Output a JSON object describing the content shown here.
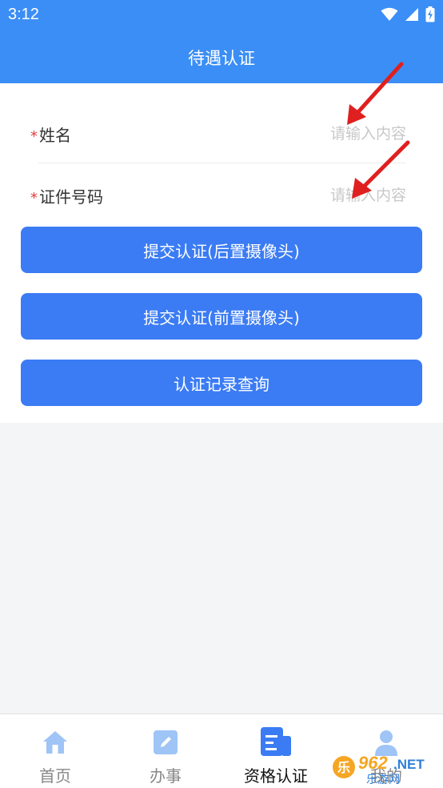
{
  "status_bar": {
    "time": "3:12",
    "icons": [
      "wifi-icon",
      "signal-icon",
      "battery-charging-icon"
    ]
  },
  "header": {
    "title": "待遇认证"
  },
  "form": {
    "fields": [
      {
        "required_mark": "*",
        "label": "姓名",
        "placeholder": "请输入内容",
        "value": ""
      },
      {
        "required_mark": "*",
        "label": "证件号码",
        "placeholder": "请输入内容",
        "value": ""
      }
    ]
  },
  "buttons": {
    "back_camera": "提交认证(后置摄像头)",
    "front_camera": "提交认证(前置摄像头)",
    "records": "认证记录查询"
  },
  "tabbar": {
    "items": [
      {
        "label": "首页",
        "icon": "home-icon",
        "active": false
      },
      {
        "label": "办事",
        "icon": "edit-icon",
        "active": false
      },
      {
        "label": "资格认证",
        "icon": "certification-icon",
        "active": true
      },
      {
        "label": "我的",
        "icon": "user-icon",
        "active": false
      }
    ]
  },
  "colors": {
    "header": "#3b8ef5",
    "button": "#3b7cf4",
    "required": "#e23c3c",
    "arrow": "#e01f1f",
    "tab_icon_inactive": "#9fc4f6",
    "tab_icon_active": "#3b7cf4"
  },
  "watermark": {
    "brand": "962.NET",
    "caption": "乐游网"
  }
}
